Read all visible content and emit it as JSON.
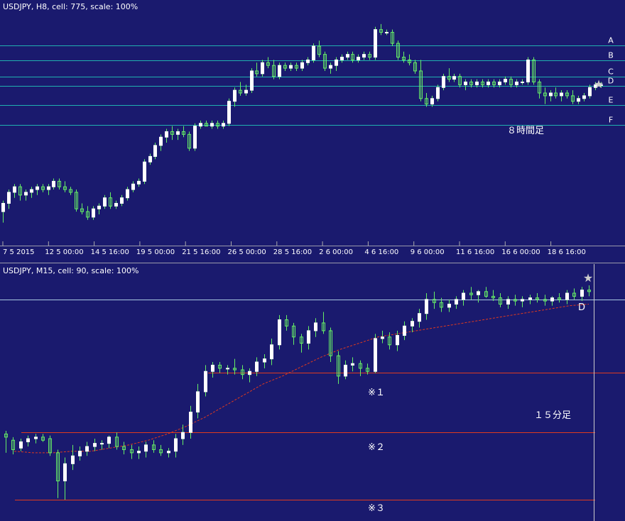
{
  "colors": {
    "background": "#1a1a6e",
    "bull_candle": "#ffffff",
    "wick": "#66ee66",
    "level_h8": "#20b0b0",
    "level_m15_top": "#a8c8e0",
    "level_red": "#e03a1e",
    "ma_line": "#e03a1e",
    "text": "#ffffff",
    "star": "#cccccc",
    "divider": "#9999aa"
  },
  "chart_data": [
    {
      "type": "candlestick",
      "header": "USDJPY, H8, cell: 775, scale: 100%",
      "annotation": "８時間足",
      "marker": "★",
      "x_ticks": [
        "7 5 2015",
        "12 5 00:00",
        "14 5 16:00",
        "19 5 00:00",
        "21 5 16:00",
        "26 5 00:00",
        "28 5 16:00",
        "2 6 00:00",
        "4 6 16:00",
        "9 6 00:00",
        "11 6 16:00",
        "16 6 00:00",
        "18 6 16:00"
      ],
      "levels": [
        {
          "label": "A",
          "price": 125.3
        },
        {
          "label": "B",
          "price": 124.76
        },
        {
          "label": "C",
          "price": 124.16
        },
        {
          "label": "D",
          "price": 123.84
        },
        {
          "label": "E",
          "price": 123.14
        },
        {
          "label": "F",
          "price": 122.41
        }
      ],
      "ohlc": [
        [
          119.28,
          119.68,
          118.88,
          119.58
        ],
        [
          119.58,
          120.08,
          119.38,
          119.98
        ],
        [
          119.98,
          120.28,
          119.78,
          120.18
        ],
        [
          120.18,
          120.28,
          119.68,
          119.88
        ],
        [
          119.88,
          120.08,
          119.68,
          119.98
        ],
        [
          119.98,
          120.18,
          119.78,
          120.08
        ],
        [
          120.08,
          120.28,
          119.88,
          120.18
        ],
        [
          120.18,
          120.28,
          119.98,
          120.08
        ],
        [
          120.08,
          120.28,
          119.88,
          120.18
        ],
        [
          120.18,
          120.48,
          120.08,
          120.38
        ],
        [
          120.38,
          120.48,
          120.08,
          120.18
        ],
        [
          120.18,
          120.38,
          119.98,
          120.08
        ],
        [
          120.08,
          120.18,
          119.88,
          119.98
        ],
        [
          119.98,
          120.08,
          119.28,
          119.38
        ],
        [
          119.38,
          119.58,
          119.18,
          119.28
        ],
        [
          119.28,
          119.48,
          118.98,
          119.08
        ],
        [
          119.08,
          119.48,
          118.98,
          119.38
        ],
        [
          119.38,
          119.58,
          119.18,
          119.48
        ],
        [
          119.48,
          119.88,
          119.38,
          119.78
        ],
        [
          119.78,
          119.98,
          119.38,
          119.48
        ],
        [
          119.48,
          119.68,
          119.38,
          119.58
        ],
        [
          119.58,
          119.88,
          119.48,
          119.78
        ],
        [
          119.78,
          120.18,
          119.68,
          120.08
        ],
        [
          120.08,
          120.38,
          119.98,
          120.28
        ],
        [
          120.28,
          120.48,
          120.18,
          120.38
        ],
        [
          120.38,
          121.18,
          120.28,
          121.08
        ],
        [
          121.08,
          121.38,
          120.98,
          121.28
        ],
        [
          121.28,
          121.78,
          121.18,
          121.68
        ],
        [
          121.68,
          122.08,
          121.48,
          121.98
        ],
        [
          121.98,
          122.28,
          121.78,
          122.18
        ],
        [
          122.18,
          122.38,
          121.88,
          122.08
        ],
        [
          122.08,
          122.28,
          121.88,
          122.18
        ],
        [
          122.18,
          122.38,
          121.98,
          122.08
        ],
        [
          122.08,
          122.18,
          121.48,
          121.58
        ],
        [
          121.58,
          122.48,
          121.48,
          122.38
        ],
        [
          122.38,
          122.58,
          122.28,
          122.48
        ],
        [
          122.48,
          122.58,
          122.38,
          122.38
        ],
        [
          122.38,
          122.58,
          122.28,
          122.48
        ],
        [
          122.48,
          122.58,
          122.28,
          122.38
        ],
        [
          122.38,
          122.58,
          122.28,
          122.48
        ],
        [
          122.48,
          123.38,
          122.38,
          123.28
        ],
        [
          123.28,
          123.78,
          123.08,
          123.68
        ],
        [
          123.68,
          123.98,
          123.48,
          123.58
        ],
        [
          123.58,
          123.88,
          123.48,
          123.68
        ],
        [
          123.68,
          124.48,
          123.58,
          124.38
        ],
        [
          124.38,
          124.68,
          124.18,
          124.28
        ],
        [
          124.28,
          124.78,
          124.18,
          124.68
        ],
        [
          124.68,
          124.88,
          124.48,
          124.58
        ],
        [
          124.58,
          124.78,
          124.08,
          124.18
        ],
        [
          124.18,
          124.68,
          124.08,
          124.58
        ],
        [
          124.58,
          124.68,
          124.38,
          124.48
        ],
        [
          124.48,
          124.68,
          124.38,
          124.58
        ],
        [
          124.58,
          124.68,
          124.38,
          124.48
        ],
        [
          124.48,
          124.78,
          124.38,
          124.68
        ],
        [
          124.68,
          124.88,
          124.58,
          124.78
        ],
        [
          124.78,
          125.38,
          124.68,
          125.28
        ],
        [
          125.28,
          125.48,
          124.88,
          124.98
        ],
        [
          124.98,
          125.08,
          124.38,
          124.48
        ],
        [
          124.48,
          124.68,
          124.28,
          124.58
        ],
        [
          124.58,
          124.88,
          124.38,
          124.78
        ],
        [
          124.78,
          124.98,
          124.68,
          124.88
        ],
        [
          124.88,
          125.08,
          124.78,
          124.98
        ],
        [
          124.98,
          125.08,
          124.68,
          124.78
        ],
        [
          124.78,
          124.98,
          124.68,
          124.88
        ],
        [
          124.88,
          125.08,
          124.78,
          124.98
        ],
        [
          124.98,
          125.08,
          124.78,
          124.88
        ],
        [
          124.88,
          125.98,
          124.78,
          125.88
        ],
        [
          125.88,
          126.08,
          125.68,
          125.78
        ],
        [
          125.78,
          125.88,
          125.68,
          125.78
        ],
        [
          125.78,
          125.88,
          125.28,
          125.38
        ],
        [
          125.38,
          125.48,
          124.78,
          124.88
        ],
        [
          124.88,
          125.08,
          124.68,
          124.78
        ],
        [
          124.78,
          124.98,
          124.58,
          124.68
        ],
        [
          124.68,
          124.78,
          124.28,
          124.38
        ],
        [
          124.38,
          124.78,
          123.28,
          123.38
        ],
        [
          123.38,
          123.58,
          123.08,
          123.18
        ],
        [
          123.18,
          123.48,
          123.08,
          123.38
        ],
        [
          123.38,
          123.88,
          123.28,
          123.78
        ],
        [
          123.78,
          124.28,
          123.68,
          124.18
        ],
        [
          124.18,
          124.48,
          123.98,
          124.08
        ],
        [
          124.08,
          124.28,
          123.98,
          124.18
        ],
        [
          124.18,
          124.28,
          123.78,
          123.88
        ],
        [
          123.88,
          124.08,
          123.68,
          123.98
        ],
        [
          123.98,
          124.08,
          123.78,
          123.88
        ],
        [
          123.88,
          124.08,
          123.78,
          123.98
        ],
        [
          123.98,
          124.08,
          123.78,
          123.88
        ],
        [
          123.88,
          124.08,
          123.78,
          123.98
        ],
        [
          123.98,
          124.08,
          123.78,
          123.88
        ],
        [
          123.88,
          124.08,
          123.78,
          123.98
        ],
        [
          123.98,
          124.18,
          123.88,
          124.08
        ],
        [
          124.08,
          124.18,
          123.78,
          123.88
        ],
        [
          123.88,
          124.08,
          123.78,
          123.98
        ],
        [
          123.98,
          124.08,
          123.88,
          123.98
        ],
        [
          123.98,
          124.88,
          123.88,
          124.78
        ],
        [
          124.78,
          124.88,
          123.88,
          123.98
        ],
        [
          123.98,
          124.08,
          123.38,
          123.58
        ],
        [
          123.58,
          123.78,
          123.18,
          123.48
        ],
        [
          123.48,
          123.68,
          123.28,
          123.58
        ],
        [
          123.58,
          123.78,
          123.38,
          123.48
        ],
        [
          123.48,
          123.68,
          123.28,
          123.58
        ],
        [
          123.58,
          123.68,
          123.38,
          123.48
        ],
        [
          123.48,
          123.68,
          123.18,
          123.28
        ],
        [
          123.28,
          123.48,
          123.18,
          123.38
        ],
        [
          123.38,
          123.58,
          123.28,
          123.48
        ],
        [
          123.48,
          123.88,
          123.38,
          123.78
        ],
        [
          123.78,
          123.98,
          123.68,
          123.88
        ],
        [
          123.88,
          123.98,
          123.78,
          123.88
        ]
      ]
    },
    {
      "type": "candlestick",
      "header": "USDJPY, M15, cell: 90, scale: 100%",
      "annotation": "１５分足",
      "marker": "★",
      "levels": [
        {
          "label": "D",
          "price": 123.84
        },
        {
          "label": "※１",
          "price": 123.37
        },
        {
          "label": "※２",
          "price": 122.99
        },
        {
          "label": "※３",
          "price": 122.56
        }
      ],
      "moving_average": [
        122.87,
        122.86,
        122.86,
        122.87,
        122.87,
        122.89,
        122.91,
        122.94,
        122.98,
        123.03,
        123.09,
        123.16,
        123.23,
        123.3,
        123.35,
        123.41,
        123.47,
        123.52,
        123.56,
        123.6,
        123.62,
        123.64,
        123.66,
        123.68,
        123.7,
        123.72,
        123.74,
        123.76,
        123.78,
        123.8,
        123.81
      ],
      "ohlc": [
        [
          122.98,
          123.0,
          122.86,
          122.96
        ],
        [
          122.94,
          122.96,
          122.85,
          122.88
        ],
        [
          122.89,
          122.95,
          122.87,
          122.93
        ],
        [
          122.93,
          122.97,
          122.9,
          122.95
        ],
        [
          122.95,
          122.98,
          122.92,
          122.96
        ],
        [
          122.96,
          122.98,
          122.93,
          122.94
        ],
        [
          122.95,
          122.97,
          122.84,
          122.86
        ],
        [
          122.86,
          122.88,
          122.57,
          122.68
        ],
        [
          122.68,
          122.83,
          122.56,
          122.79
        ],
        [
          122.79,
          122.91,
          122.75,
          122.84
        ],
        [
          122.84,
          122.9,
          122.81,
          122.87
        ],
        [
          122.87,
          122.93,
          122.84,
          122.9
        ],
        [
          122.9,
          122.95,
          122.87,
          122.92
        ],
        [
          122.92,
          122.94,
          122.88,
          122.92
        ],
        [
          122.92,
          122.97,
          122.89,
          122.96
        ],
        [
          122.96,
          122.99,
          122.88,
          122.9
        ],
        [
          122.9,
          122.93,
          122.85,
          122.88
        ],
        [
          122.88,
          122.91,
          122.82,
          122.86
        ],
        [
          122.86,
          122.9,
          122.82,
          122.87
        ],
        [
          122.87,
          122.93,
          122.83,
          122.91
        ],
        [
          122.91,
          122.94,
          122.86,
          122.88
        ],
        [
          122.88,
          122.91,
          122.84,
          122.86
        ],
        [
          122.86,
          122.89,
          122.83,
          122.87
        ],
        [
          122.87,
          122.98,
          122.83,
          122.95
        ],
        [
          122.95,
          123.04,
          122.91,
          122.99
        ],
        [
          122.99,
          123.16,
          122.95,
          123.12
        ],
        [
          123.12,
          123.3,
          123.08,
          123.25
        ],
        [
          123.25,
          123.42,
          123.22,
          123.38
        ],
        [
          123.38,
          123.44,
          123.34,
          123.42
        ],
        [
          123.42,
          123.44,
          123.37,
          123.4
        ],
        [
          123.4,
          123.42,
          123.36,
          123.4
        ],
        [
          123.4,
          123.46,
          123.36,
          123.39
        ],
        [
          123.39,
          123.42,
          123.33,
          123.36
        ],
        [
          123.36,
          123.4,
          123.31,
          123.38
        ],
        [
          123.38,
          123.47,
          123.35,
          123.44
        ],
        [
          123.44,
          123.49,
          123.4,
          123.46
        ],
        [
          123.46,
          123.59,
          123.42,
          123.55
        ],
        [
          123.55,
          123.74,
          123.52,
          123.71
        ],
        [
          123.71,
          123.74,
          123.64,
          123.67
        ],
        [
          123.67,
          123.69,
          123.55,
          123.6
        ],
        [
          123.6,
          123.62,
          123.5,
          123.56
        ],
        [
          123.56,
          123.67,
          123.52,
          123.64
        ],
        [
          123.64,
          123.72,
          123.6,
          123.69
        ],
        [
          123.69,
          123.76,
          123.62,
          123.64
        ],
        [
          123.64,
          123.66,
          123.44,
          123.48
        ],
        [
          123.48,
          123.51,
          123.3,
          123.35
        ],
        [
          123.35,
          123.45,
          123.33,
          123.42
        ],
        [
          123.42,
          123.47,
          123.38,
          123.43
        ],
        [
          123.43,
          123.45,
          123.35,
          123.4
        ],
        [
          123.4,
          123.43,
          123.36,
          123.38
        ],
        [
          123.38,
          123.62,
          123.37,
          123.59
        ],
        [
          123.59,
          123.64,
          123.56,
          123.6
        ],
        [
          123.6,
          123.63,
          123.52,
          123.55
        ],
        [
          123.55,
          123.64,
          123.51,
          123.61
        ],
        [
          123.61,
          123.7,
          123.58,
          123.67
        ],
        [
          123.67,
          123.72,
          123.63,
          123.7
        ],
        [
          123.7,
          123.78,
          123.66,
          123.75
        ],
        [
          123.75,
          123.88,
          123.71,
          123.84
        ],
        [
          123.84,
          123.89,
          123.78,
          123.82
        ],
        [
          123.82,
          123.85,
          123.76,
          123.79
        ],
        [
          123.79,
          123.84,
          123.76,
          123.81
        ],
        [
          123.81,
          123.86,
          123.78,
          123.84
        ],
        [
          123.84,
          123.9,
          123.8,
          123.88
        ],
        [
          123.88,
          123.92,
          123.84,
          123.87
        ],
        [
          123.87,
          123.9,
          123.82,
          123.89
        ],
        [
          123.89,
          123.92,
          123.85,
          123.86
        ],
        [
          123.86,
          123.9,
          123.83,
          123.85
        ],
        [
          123.85,
          123.88,
          123.79,
          123.81
        ],
        [
          123.81,
          123.86,
          123.78,
          123.84
        ],
        [
          123.84,
          123.87,
          123.8,
          123.83
        ],
        [
          123.83,
          123.86,
          123.79,
          123.84
        ],
        [
          123.84,
          123.87,
          123.81,
          123.85
        ],
        [
          123.85,
          123.88,
          123.82,
          123.84
        ],
        [
          123.84,
          123.87,
          123.8,
          123.83
        ],
        [
          123.83,
          123.86,
          123.8,
          123.85
        ],
        [
          123.85,
          123.88,
          123.82,
          123.84
        ],
        [
          123.84,
          123.9,
          123.81,
          123.88
        ],
        [
          123.88,
          123.91,
          123.84,
          123.86
        ],
        [
          123.86,
          123.92,
          123.83,
          123.9
        ],
        [
          123.9,
          123.93,
          123.86,
          123.89
        ]
      ]
    }
  ]
}
